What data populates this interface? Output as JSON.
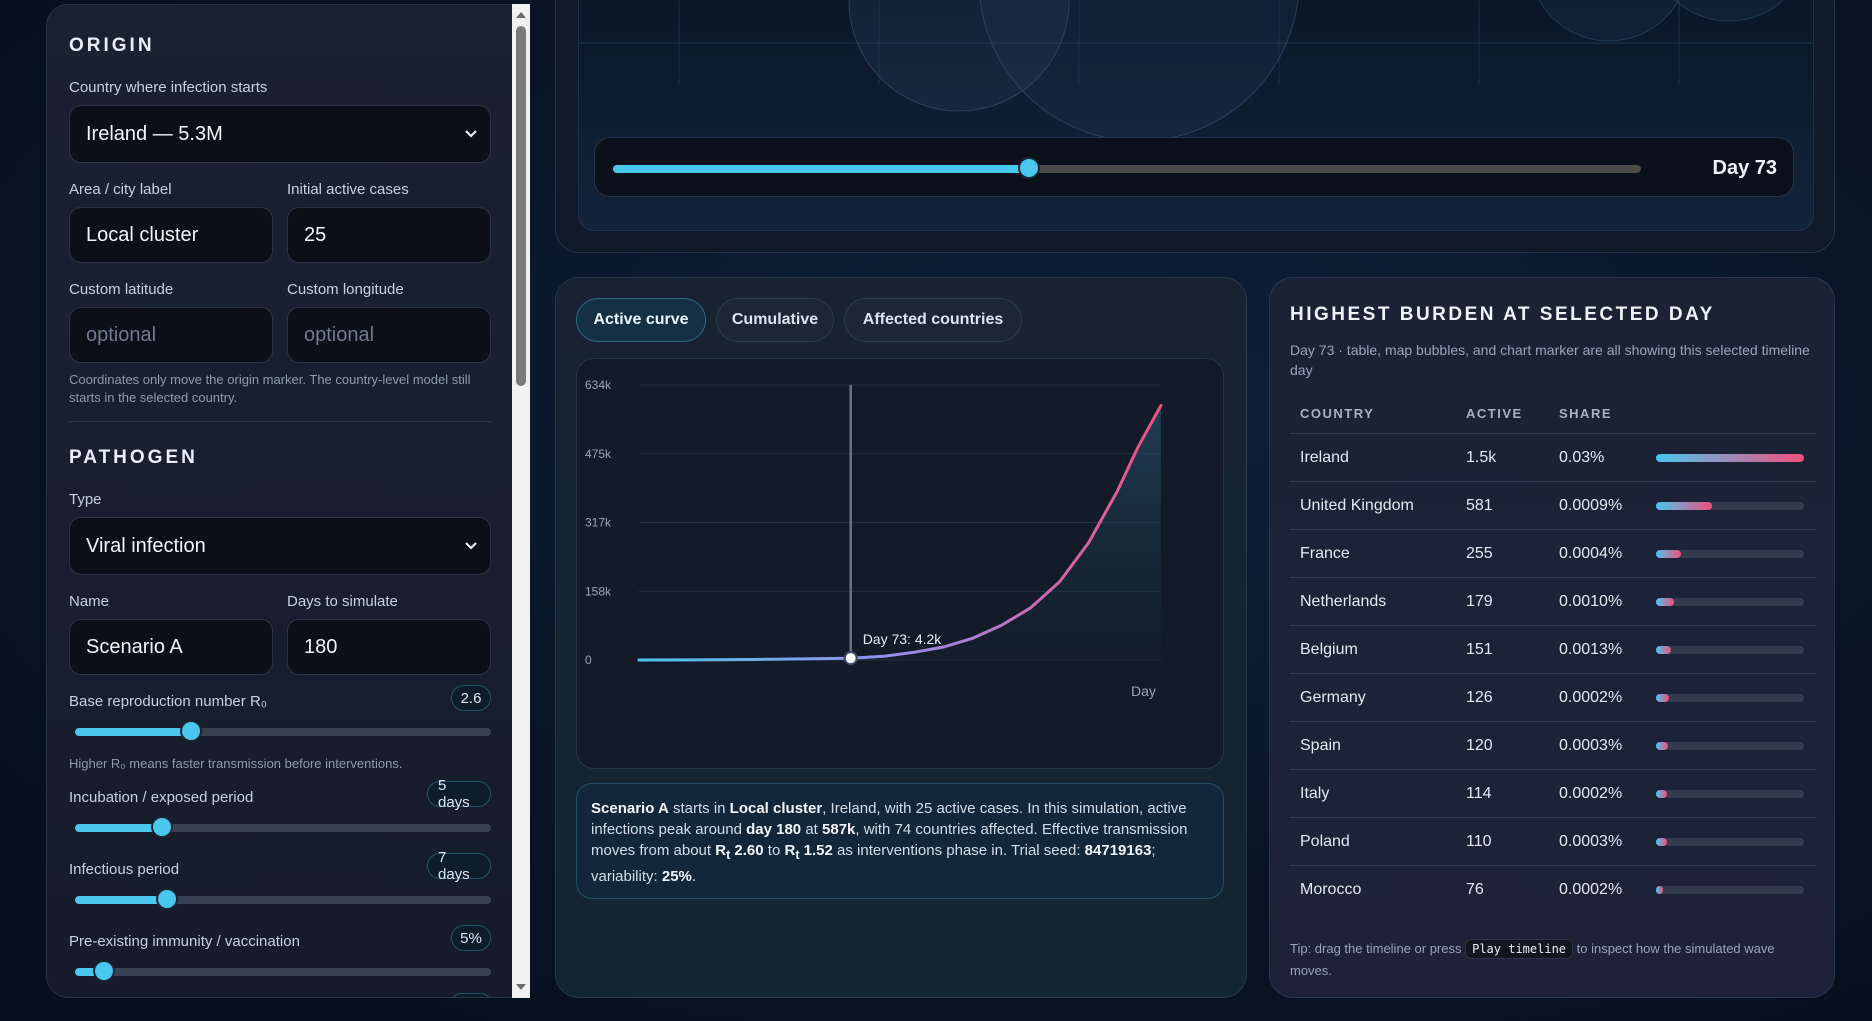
{
  "origin": {
    "title": "ORIGIN",
    "country_label": "Country where infection starts",
    "country_value": "Ireland — 5.3M",
    "area_label": "Area / city label",
    "area_value": "Local cluster",
    "cases_label": "Initial active cases",
    "cases_value": "25",
    "lat_label": "Custom latitude",
    "lat_placeholder": "optional",
    "lon_label": "Custom longitude",
    "lon_placeholder": "optional",
    "hint": "Coordinates only move the origin marker. The country-level model still starts in the selected country."
  },
  "pathogen": {
    "title": "PATHOGEN",
    "type_label": "Type",
    "type_value": "Viral infection",
    "name_label": "Name",
    "name_value": "Scenario A",
    "days_label": "Days to simulate",
    "days_value": "180",
    "r0_label": "Base reproduction number R₀",
    "r0_value": "2.6",
    "r0_fraction": 0.28,
    "r0_hint": "Higher R₀ means faster transmission before interventions.",
    "incubation_label": "Incubation / exposed period",
    "incubation_value": "5 days",
    "incubation_fraction": 0.21,
    "infectious_label": "Infectious period",
    "infectious_value": "7 days",
    "infectious_fraction": 0.22,
    "immunity_label": "Pre-existing immunity / vaccination",
    "immunity_value": "5%",
    "immunity_fraction": 0.07
  },
  "timeline": {
    "day_label": "Day 73",
    "fraction": 0.405
  },
  "tabs": [
    "Active curve",
    "Cumulative",
    "Affected countries"
  ],
  "chart_data": {
    "type": "line",
    "xlabel": "Day",
    "ylabel": "",
    "xlim": [
      0,
      180
    ],
    "ylim": [
      0,
      634000
    ],
    "yticks": [
      "634k",
      "475k",
      "317k",
      "158k",
      "0"
    ],
    "marker_label": "Day 73: 4.2k",
    "marker_day": 73,
    "marker_value": 4200,
    "series": [
      {
        "x": [
          0,
          20,
          40,
          60,
          73,
          85,
          95,
          105,
          115,
          125,
          135,
          145,
          155,
          165,
          172,
          180
        ],
        "values": [
          25,
          300,
          1200,
          2800,
          4200,
          9000,
          18000,
          30000,
          50000,
          80000,
          120000,
          180000,
          270000,
          390000,
          490000,
          587000
        ]
      }
    ]
  },
  "summary": {
    "s1": "Scenario A",
    "s2": " starts in ",
    "s3": "Local cluster",
    "s4": ", Ireland, with 25 active cases. In this simulation, active infections peak around ",
    "s5": "day 180",
    "s6": " at ",
    "s7": "587k",
    "s8": ", with 74 countries affected. Effective transmission moves from about ",
    "s9": "R",
    "s9sub": "t",
    "s10": " 2.60",
    "s11": " to ",
    "s12": "R",
    "s12sub": "t",
    "s13": " 1.52",
    "s14": " as interventions phase in. Trial seed: ",
    "s15": "84719163",
    "s16": "; variability: ",
    "s17": "25%",
    "s18": "."
  },
  "burden": {
    "title": "HIGHEST BURDEN AT SELECTED DAY",
    "subtitle": "Day 73 · table, map bubbles, and chart marker are all showing this selected timeline day",
    "col_country": "COUNTRY",
    "col_active": "ACTIVE",
    "col_share": "SHARE",
    "rows": [
      {
        "country": "Ireland",
        "active": "1.5k",
        "share": "0.03%",
        "fraction": 1.0
      },
      {
        "country": "United Kingdom",
        "active": "581",
        "share": "0.0009%",
        "fraction": 0.38
      },
      {
        "country": "France",
        "active": "255",
        "share": "0.0004%",
        "fraction": 0.17
      },
      {
        "country": "Netherlands",
        "active": "179",
        "share": "0.0010%",
        "fraction": 0.12
      },
      {
        "country": "Belgium",
        "active": "151",
        "share": "0.0013%",
        "fraction": 0.1
      },
      {
        "country": "Germany",
        "active": "126",
        "share": "0.0002%",
        "fraction": 0.085
      },
      {
        "country": "Spain",
        "active": "120",
        "share": "0.0003%",
        "fraction": 0.08
      },
      {
        "country": "Italy",
        "active": "114",
        "share": "0.0002%",
        "fraction": 0.076
      },
      {
        "country": "Poland",
        "active": "110",
        "share": "0.0003%",
        "fraction": 0.073
      },
      {
        "country": "Morocco",
        "active": "76",
        "share": "0.0002%",
        "fraction": 0.05
      }
    ],
    "tip_before": "Tip: drag the timeline or press ",
    "tip_code": "Play timeline",
    "tip_after": " to inspect how the simulated wave moves."
  },
  "colors": {
    "accent": "#49c7ef",
    "pink": "#f0507e",
    "panel": "#161c2b"
  }
}
